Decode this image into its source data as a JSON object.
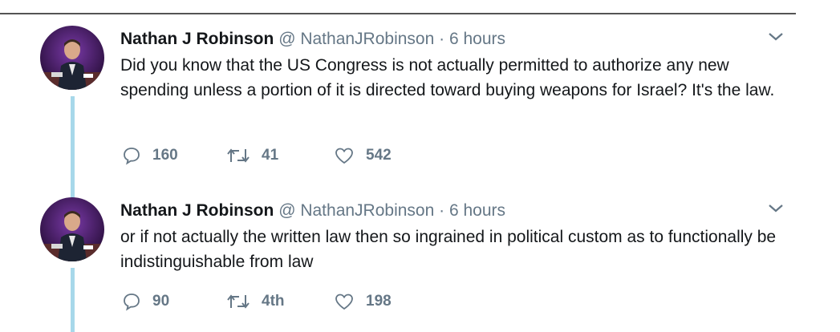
{
  "tweets": [
    {
      "name": "Nathan J Robinson",
      "handle": "@ NathanJRobinson",
      "dot": "·",
      "time": "6 hours",
      "text": "Did you know that the US Congress is not actually permitted to authorize any new spending unless a portion of it is directed toward buying weapons for Israel? It's the law.",
      "replies": "160",
      "retweets": "41",
      "likes": "542"
    },
    {
      "name": "Nathan J Robinson",
      "handle": "@ NathanJRobinson",
      "dot": "·",
      "time": "6 hours",
      "text": "or if not actually the written law then so ingrained in political custom as to functionally be indistinguishable from law",
      "replies": "90",
      "retweets": "4th",
      "likes": "198"
    }
  ],
  "icons": {
    "reply": "reply-icon",
    "retweet": "retweet-icon",
    "like": "heart-icon",
    "menu": "chevron-down-icon"
  },
  "colors": {
    "thread_line": "#a7d8ea",
    "secondary_text": "#657786"
  }
}
